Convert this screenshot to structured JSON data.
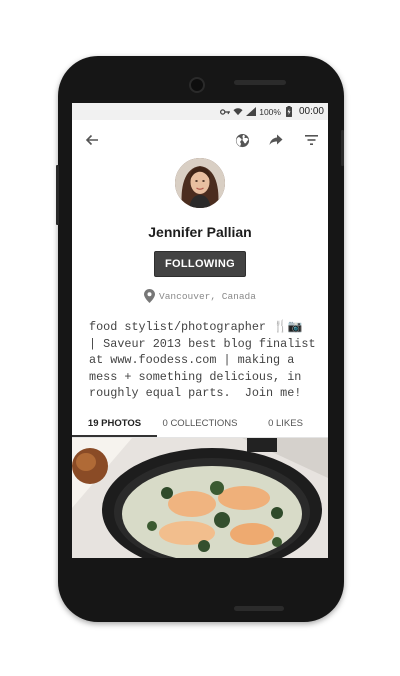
{
  "status_bar": {
    "battery_percent": "100%",
    "time": "00:00",
    "icons": [
      "key-icon",
      "wifi-icon",
      "signal-icon",
      "battery-charging-icon"
    ]
  },
  "toolbar": {
    "back_icon": "back-arrow-icon",
    "actions": [
      "globe-icon",
      "share-icon",
      "filter-icon"
    ]
  },
  "profile": {
    "name": "Jennifer Pallian",
    "follow_label": "FOLLOWING",
    "location": "Vancouver, Canada",
    "bio": "food stylist/photographer 🍴📷\n| Saveur 2013 best blog finalist\nat www.foodess.com | making a\nmess + something delicious, in\nroughly equal parts.  Join me!"
  },
  "tabs": [
    {
      "label": "19 PHOTOS",
      "active": true
    },
    {
      "label": "0 COLLECTIONS",
      "active": false
    },
    {
      "label": "0 LIKES",
      "active": false
    }
  ],
  "colors": {
    "button_bg": "#434343",
    "tab_indicator": "#333333"
  }
}
